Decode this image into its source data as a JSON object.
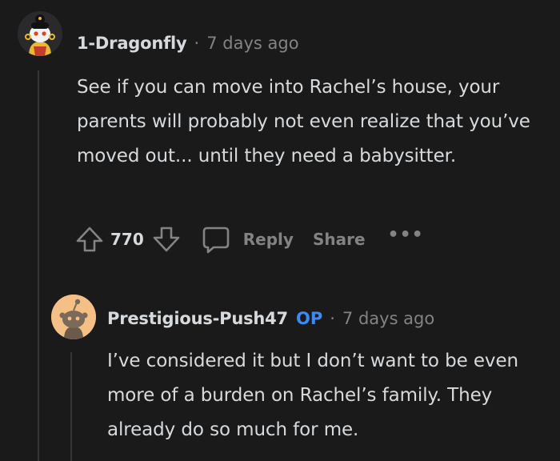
{
  "comments": [
    {
      "username": "1-Dragonfly",
      "separator": "·",
      "time": "7 days ago",
      "body": "See if you can move into Rachel’s house, your parents will probably not even realize that you’ve moved out... until they need a babysitter.",
      "votes": "770",
      "reply_label": "Reply",
      "share_label": "Share",
      "more_label": "•••",
      "avatar_icon": "snoo-avatar-gold-costume"
    },
    {
      "username": "Prestigious-Push47",
      "op_badge": "OP",
      "separator": "·",
      "time": "7 days ago",
      "body": "I’ve considered it but I don’t want to be even more of a burden on Rachel’s family. They already do so much for me.",
      "avatar_icon": "snoo-avatar-default"
    }
  ],
  "colors": {
    "background": "#1a1a1b",
    "text": "#d7dadc",
    "muted": "#818384",
    "op_badge": "#3d8bf2",
    "thread_line": "#343536"
  }
}
